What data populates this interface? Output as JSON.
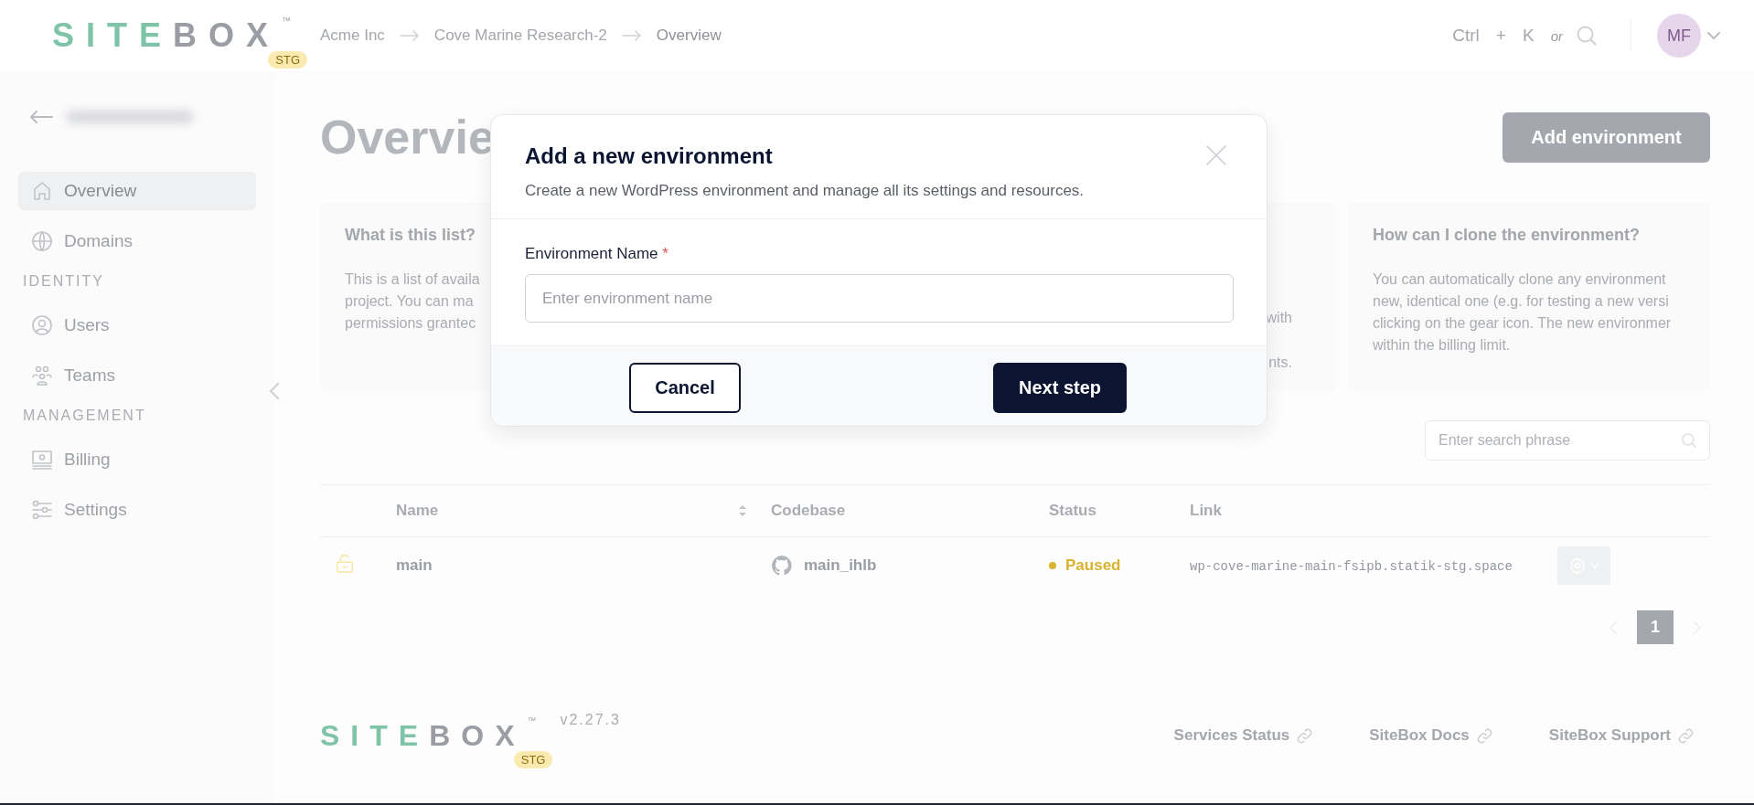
{
  "topbar": {
    "logo": {
      "text_a": "SITE",
      "text_b": "BOX",
      "trademark": "™",
      "badge": "STG"
    },
    "breadcrumbs": [
      {
        "label": "Acme Inc"
      },
      {
        "label": "Cove Marine Research-2"
      },
      {
        "label": "Overview"
      }
    ],
    "shortcut": {
      "keys": [
        "Ctrl",
        "K"
      ],
      "plus": "+",
      "or": "or"
    },
    "avatar": {
      "initials": "MF"
    }
  },
  "sidebar": {
    "sections": [
      {
        "items": [
          {
            "label": "Overview",
            "selected": true
          },
          {
            "label": "Domains",
            "selected": false
          }
        ]
      },
      {
        "heading": "IDENTITY",
        "items": [
          {
            "label": "Users",
            "selected": false
          },
          {
            "label": "Teams",
            "selected": false
          }
        ]
      },
      {
        "heading": "MANAGEMENT",
        "items": [
          {
            "label": "Billing",
            "selected": false
          },
          {
            "label": "Settings",
            "selected": false
          }
        ]
      }
    ]
  },
  "page": {
    "title": "Overvie",
    "add_button": "Add environment",
    "cards": [
      {
        "title": "What is this list?",
        "lines": [
          "This is a list of availa",
          "project. You can ma",
          "permissions grantec"
        ]
      },
      {
        "lines": [
          "with",
          "nts."
        ]
      },
      {
        "title": "How can I clone the environment?",
        "lines": [
          "You can automatically clone any environment",
          "new, identical one (e.g. for testing a new versi",
          "clicking on the gear icon. The new environmer",
          "within the billing limit."
        ]
      }
    ],
    "search": {
      "placeholder": "Enter search phrase"
    },
    "table": {
      "columns": [
        {
          "label": "Name",
          "sortable": true
        },
        {
          "label": "Codebase",
          "sortable": false
        },
        {
          "label": "Status",
          "sortable": false
        },
        {
          "label": "Link",
          "sortable": false
        }
      ],
      "rows": [
        {
          "name": "main",
          "codebase": "main_ihlb",
          "status": "Paused",
          "color": "#d9b32f",
          "link": "wp-cove-marine-main-fsipb.statik-stg.space"
        }
      ]
    },
    "pagination": {
      "pages": [
        {
          "label": "1",
          "selected": true
        }
      ]
    }
  },
  "footer": {
    "logo": {
      "text_a": "SITE",
      "text_b": "BOX",
      "trademark": "™",
      "badge": "STG"
    },
    "version": "v2.27.3",
    "links": [
      "Services Status",
      "SiteBox Docs",
      "SiteBox Support"
    ]
  },
  "modal": {
    "title": "Add a new environment",
    "subtitle": "Create a new WordPress environment and manage all its settings and resources.",
    "field": {
      "label": "Environment Name",
      "required_mark": "*",
      "placeholder": "Enter environment name"
    },
    "buttons": [
      {
        "label": "Cancel",
        "kind": "secondary"
      },
      {
        "label": "Next step",
        "kind": "primary"
      }
    ]
  }
}
